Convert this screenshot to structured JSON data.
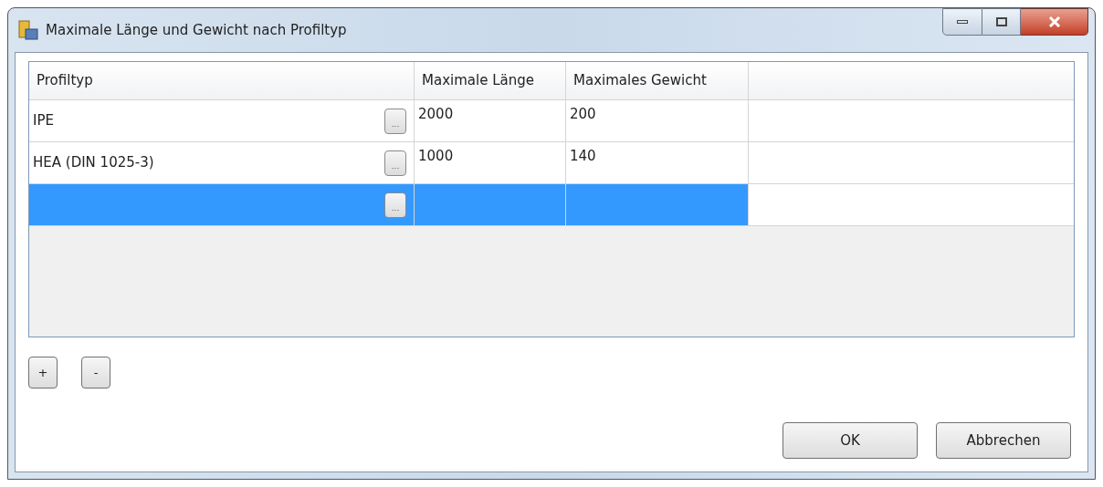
{
  "window": {
    "title": "Maximale Länge und Gewicht nach Profiltyp"
  },
  "table": {
    "columns": [
      "Profiltyp",
      "Maximale Länge",
      "Maximales Gewicht"
    ],
    "rows": [
      {
        "cells": [
          "IPE",
          "2000",
          "200"
        ],
        "browse": "...",
        "selected": false
      },
      {
        "cells": [
          "HEA (DIN 1025-3)",
          "1000",
          "140"
        ],
        "browse": "...",
        "selected": false
      },
      {
        "cells": [
          "",
          "",
          ""
        ],
        "browse": "...",
        "selected": true
      }
    ]
  },
  "row_buttons": [
    "+",
    "-"
  ],
  "buttons": [
    "OK",
    "Abbrechen"
  ]
}
